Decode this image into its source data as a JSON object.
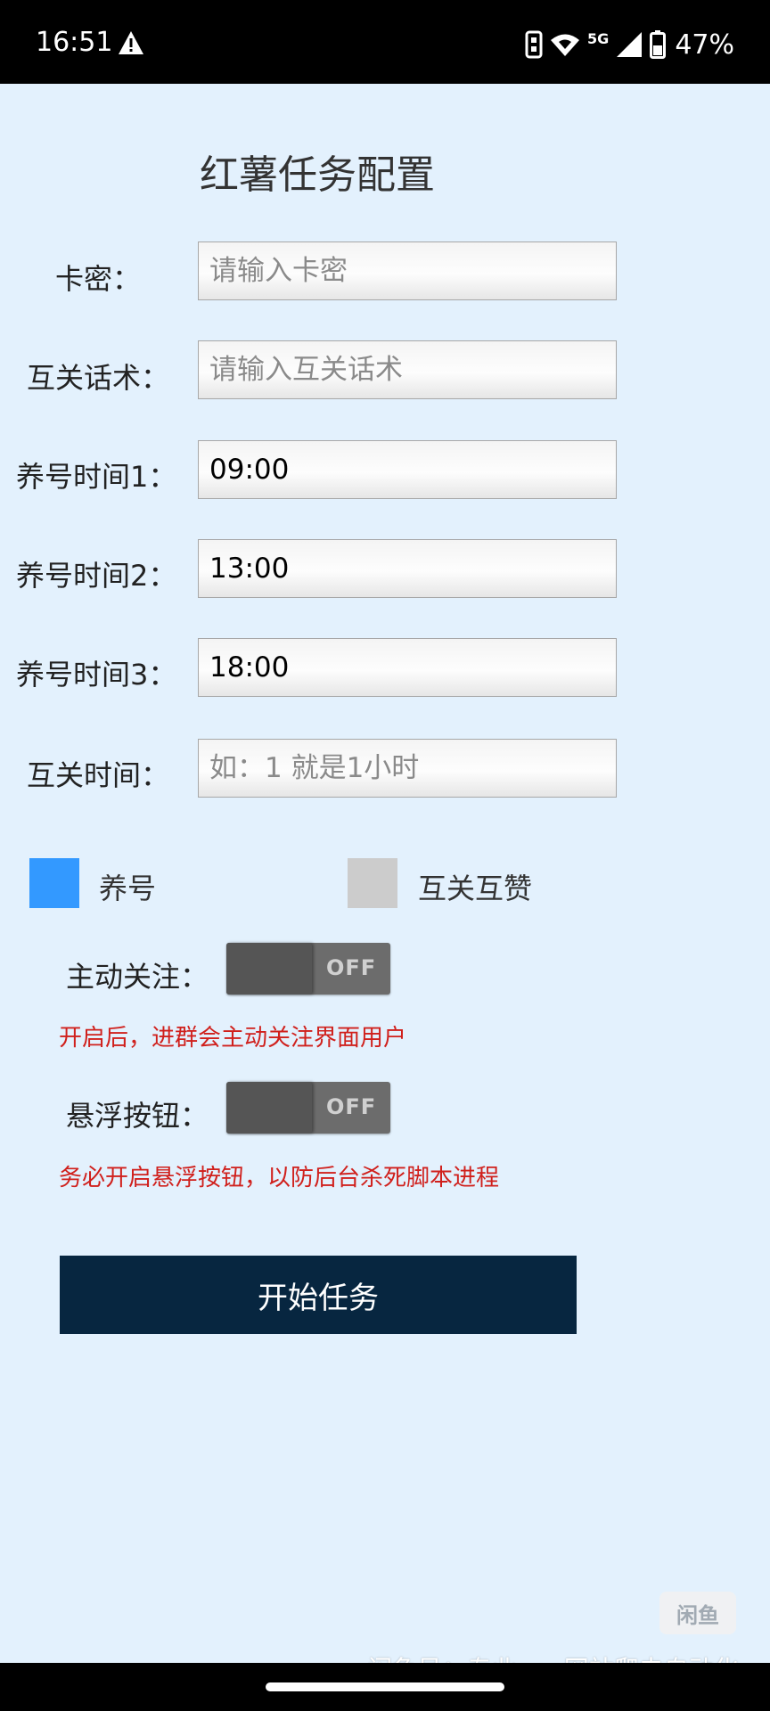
{
  "status_bar": {
    "time": "16:51",
    "network": "5G",
    "battery": "47%"
  },
  "title": "红薯任务配置",
  "form": {
    "card_key": {
      "label": "卡密：",
      "value": "",
      "placeholder": "请输入卡密"
    },
    "mutual_script": {
      "label": "互关话术：",
      "value": "",
      "placeholder": "请输入互关话术"
    },
    "time1": {
      "label": "养号时间1：",
      "value": "09:00",
      "placeholder": ""
    },
    "time2": {
      "label": "养号时间2：",
      "value": "13:00",
      "placeholder": ""
    },
    "time3": {
      "label": "养号时间3：",
      "value": "18:00",
      "placeholder": ""
    },
    "mutual_time": {
      "label": "互关时间：",
      "value": "",
      "placeholder": "如：1 就是1小时"
    }
  },
  "checkboxes": {
    "nurture": {
      "label": "养号",
      "checked": true,
      "color": "#3399ff"
    },
    "mutual_like": {
      "label": "互关互赞",
      "checked": false,
      "color": "#cccccc"
    }
  },
  "auto_follow": {
    "label": "主动关注：",
    "state": "OFF",
    "hint": "开启后，进群会主动关注界面用户"
  },
  "floating_button": {
    "label": "悬浮按钮：",
    "state": "OFF",
    "hint": "务必开启悬浮按钮，以防后台杀死脚本进程"
  },
  "start_button": {
    "label": "开始任务",
    "color": "#072640"
  },
  "watermark": {
    "badge": "闲鱼",
    "text": "闲鱼号：专业app网站爬虫自动化"
  },
  "colors": {
    "background": "#e3f1fd",
    "hint": "#d0201c"
  }
}
